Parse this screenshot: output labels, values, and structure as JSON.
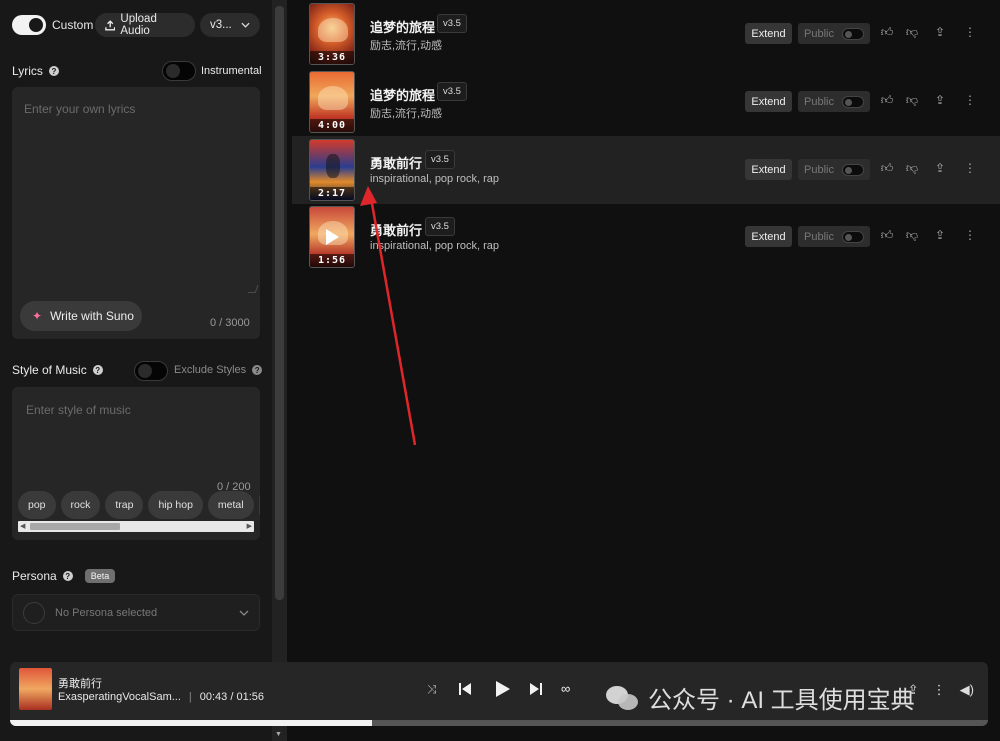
{
  "top": {
    "custom_label": "Custom",
    "upload_label": "Upload Audio",
    "version_label": "v3..."
  },
  "lyrics": {
    "label": "Lyrics",
    "instrumental_label": "Instrumental",
    "placeholder": "Enter your own lyrics",
    "write_label": "Write with Suno",
    "counter": "0 / 3000"
  },
  "style": {
    "label": "Style of Music",
    "exclude_label": "Exclude Styles",
    "placeholder": "Enter style of music",
    "counter": "0 / 200",
    "tags": [
      "pop",
      "rock",
      "trap",
      "hip hop",
      "metal"
    ]
  },
  "persona": {
    "label": "Persona",
    "badge": "Beta",
    "placeholder": "No Persona selected"
  },
  "songs": [
    {
      "title": "追梦的旅程",
      "version": "v3.5",
      "tags": "励志,流行,动感",
      "duration": "3:36",
      "extend": "Extend",
      "public": "Public"
    },
    {
      "title": "追梦的旅程",
      "version": "v3.5",
      "tags": "励志,流行,动感",
      "duration": "4:00",
      "extend": "Extend",
      "public": "Public"
    },
    {
      "title": "勇敢前行",
      "version": "v3.5",
      "tags": "inspirational, pop rock, rap",
      "duration": "2:17",
      "extend": "Extend",
      "public": "Public"
    },
    {
      "title": "勇敢前行",
      "version": "v3.5",
      "tags": "inspirational, pop rock, rap",
      "duration": "1:56",
      "extend": "Extend",
      "public": "Public"
    }
  ],
  "player": {
    "title": "勇敢前行",
    "artist": "ExasperatingVocalSam...",
    "time": "00:43 / 01:56",
    "progress": 0.37
  },
  "watermark": {
    "text": "公众号 · AI 工具使用宝典"
  },
  "colors": {
    "annotation_arrow": "#e0262a",
    "accent_pink": "#ff6b9a"
  }
}
